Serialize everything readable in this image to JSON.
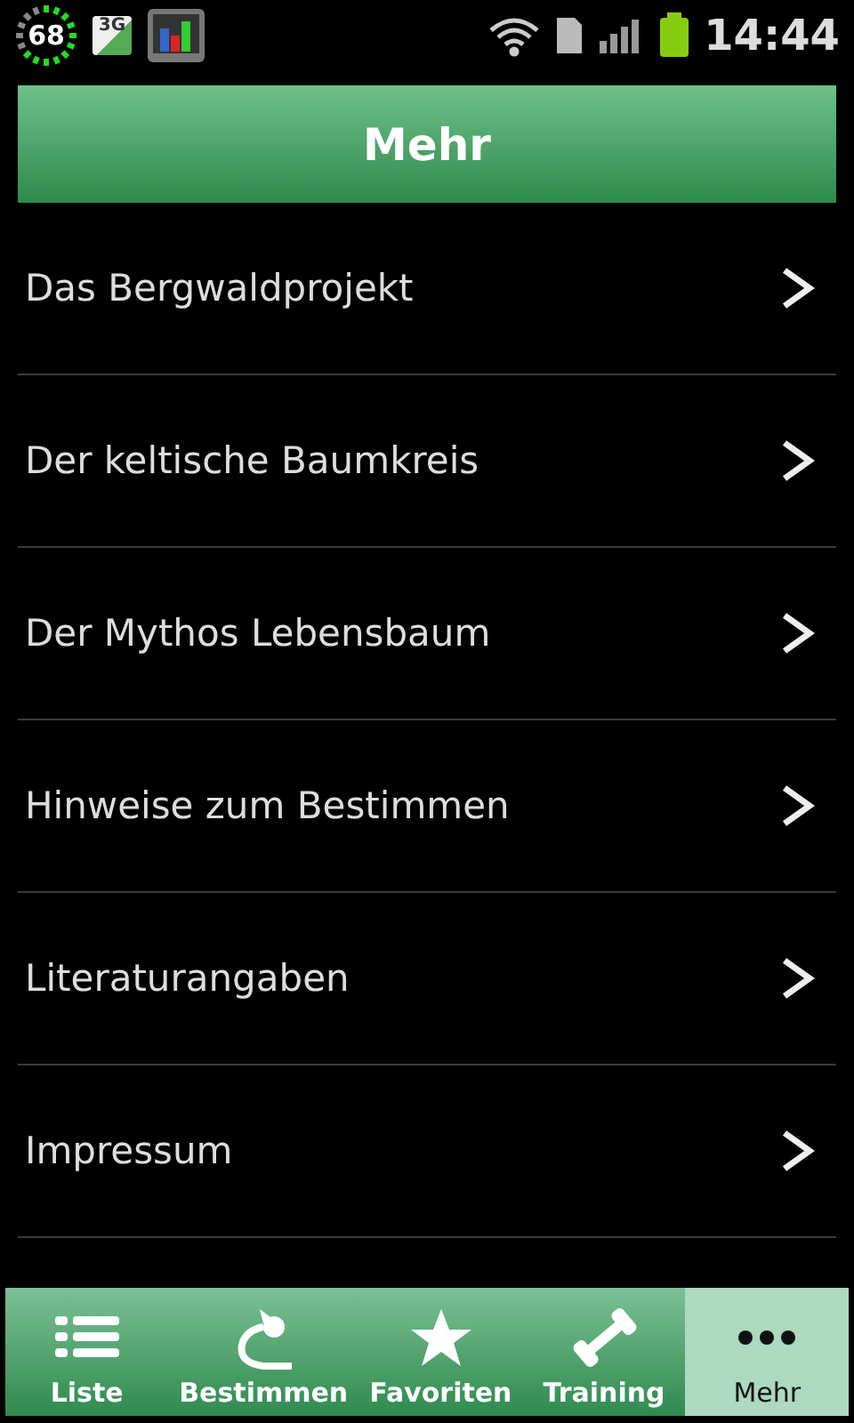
{
  "status_bar": {
    "battery_widget": "68",
    "network_badge": "3G",
    "time": "14:44"
  },
  "header": {
    "title": "Mehr"
  },
  "items": [
    {
      "label": "Das Bergwaldprojekt"
    },
    {
      "label": "Der keltische Baumkreis"
    },
    {
      "label": "Der Mythos Lebensbaum"
    },
    {
      "label": "Hinweise zum Bestimmen"
    },
    {
      "label": "Literaturangaben"
    },
    {
      "label": "Impressum"
    }
  ],
  "tabs": [
    {
      "label": "Liste",
      "kind": "list",
      "selected": false
    },
    {
      "label": "Bestimmen",
      "kind": "identify",
      "selected": false
    },
    {
      "label": "Favoriten",
      "kind": "star",
      "selected": false
    },
    {
      "label": "Training",
      "kind": "dumbbell",
      "selected": false
    },
    {
      "label": "Mehr",
      "kind": "more",
      "selected": true
    }
  ]
}
